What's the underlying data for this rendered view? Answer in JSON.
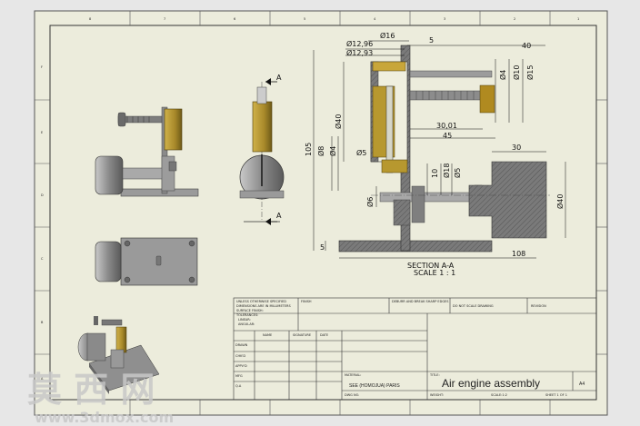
{
  "border": {
    "columns": [
      "8",
      "7",
      "6",
      "5",
      "4",
      "3",
      "2",
      "1"
    ],
    "rows": [
      "F",
      "E",
      "D",
      "C",
      "B",
      "A"
    ]
  },
  "section_view": {
    "cut_label_top": "A",
    "cut_label_bottom": "A",
    "caption_line1": "SECTION A-A",
    "caption_line2": "SCALE 1 : 1"
  },
  "dimensions": {
    "d16": "Ø16",
    "d5_top": "5",
    "d12_96": "Ø12,96",
    "d12_93": "Ø12,93",
    "d40_top": "40",
    "d4_right": "Ø4",
    "d10_right": "Ø10",
    "d15_right": "Ø15",
    "d40_left": "Ø40",
    "d105": "105",
    "d8": "Ø8",
    "d4_left": "Ø4",
    "d5_mid": "Ø5",
    "d30_01": "30,01",
    "d45": "45",
    "d30": "30",
    "d10_mid": "10",
    "d18_mid": "Ø18",
    "d5_mid2": "Ø5",
    "d6": "Ø6",
    "d40_flywheel": "Ø40",
    "d5_bottom": "5",
    "d108": "108"
  },
  "title_block": {
    "title": "Air engine assembly",
    "sheet": "A4",
    "school": "SEE (HOMOJUA) PARIS",
    "notes_lines": [
      "UNLESS OTHERWISE SPECIFIED",
      "DIMENSIONS ARE IN MILLIMETERS",
      "SURFACE FINISH:",
      "TOLERANCES:",
      "LINEAR:",
      "ANGULAR:"
    ],
    "finish": "FINISH",
    "deburr": "DEBURR AND BREAK SHARP EDGES",
    "dont_scale": "DO NOT SCALE DRAWING",
    "revision": "REVISION",
    "rows": [
      "DRAWN",
      "CHK'D",
      "APPV'D",
      "MFG",
      "Q.A"
    ],
    "cols": [
      "NAME",
      "SIGNATURE",
      "DATE"
    ],
    "material": "MATERIAL:",
    "title_label": "TITLE:",
    "dwg_no": "DWG NO.",
    "weight": "WEIGHT:",
    "scale": "SCALE:1:2",
    "sheet_of": "SHEET 1 OF 1"
  },
  "watermark": {
    "main": "莫 西 网",
    "url": "www.3dmox.com"
  },
  "colors": {
    "paper": "#ececdc",
    "brass": "#a8892a",
    "steel": "#8f8f8f",
    "hatch": "#6d6d6d"
  }
}
